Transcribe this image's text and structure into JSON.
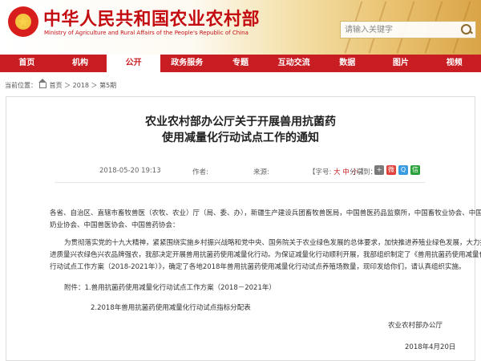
{
  "header": {
    "title": "中华人民共和国农业农村部",
    "subtitle": "Ministry of Agriculture and Rural Affairs of the People's Republic of China",
    "emblem_glyph": "★",
    "search": {
      "placeholder": "请输入关键字"
    }
  },
  "nav": {
    "items": [
      {
        "label": "首页",
        "active": false
      },
      {
        "label": "机构",
        "active": false
      },
      {
        "label": "公开",
        "active": true
      },
      {
        "label": "政务服务",
        "active": false
      },
      {
        "label": "专题",
        "active": false
      },
      {
        "label": "互动交流",
        "active": false
      },
      {
        "label": "数据",
        "active": false
      },
      {
        "label": "图片",
        "active": false
      },
      {
        "label": "视频",
        "active": false
      }
    ]
  },
  "breadcrumb": {
    "prefix": "当前位置：",
    "home": "首页",
    "sep": "＞",
    "year": "2018",
    "issue": "第5期"
  },
  "article": {
    "title_line1": "农业农村部办公厅关于开展兽用抗菌药",
    "title_line2": "使用减量化行动试点工作的通知",
    "date": "2018-05-20 19:13",
    "author_label": "作者:",
    "source_label": "来源:",
    "font_label": "【字号:",
    "font_large": "大",
    "font_medium": "中",
    "font_small": "小",
    "font_close": "】",
    "share_label": "分享到：",
    "addressee_line1": "各省、自治区、直辖市畜牧兽医（农牧、农业）厅（局、委、办），新疆生产建设兵团畜牧兽医局，中国兽医药品监察所，中国畜牧业协会、中国",
    "addressee_line2": "奶业协会、中国兽医协会、中国兽药协会：",
    "body_line1": "为贯彻落实党的十九大精神，紧紧围绕实施乡村振兴战略和党中央、国务院关于农业绿色发展的总体要求，加快推进养殖业绿色发展，大力推",
    "body_line2": "进质量兴农绿色兴农品牌强农，我部决定开展兽用抗菌药使用减量化行动。为保证减量化行动顺利开展，我部组织制定了《兽用抗菌药使用减量化",
    "body_line3": "行动试点工作方案（2018-2021年）》，确定了各地2018年兽用抗菌药使用减量化行动试点养殖场数量，现印发给你们，请认真组织实施。",
    "attach_line1": "附件：1.兽用抗菌药使用减量化行动试点工作方案（2018－2021年）",
    "attach_line2": "2.2018年兽用抗菌药使用减量化行动试点指标分配表",
    "signature": "农业农村部办公厅",
    "sign_date": "2018年4月20日"
  },
  "colors": {
    "brand_red": "#c81d22",
    "title_red": "#c40d13"
  }
}
